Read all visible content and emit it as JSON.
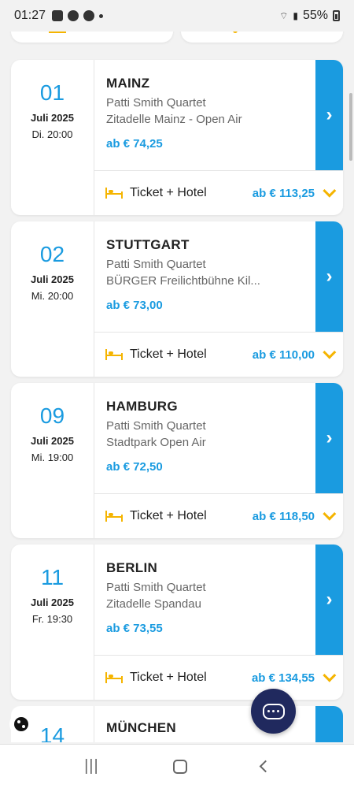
{
  "status_bar": {
    "time": "01:27",
    "battery": "55%"
  },
  "events": [
    {
      "day": "01",
      "month": "Juli 2025",
      "weekday_time": "Di. 20:00",
      "city": "MAINZ",
      "artist": "Patti Smith Quartet",
      "venue": "Zitadelle Mainz - Open Air",
      "price": "ab € 74,25",
      "hotel_label": "Ticket + Hotel",
      "hotel_price": "ab € 113,25"
    },
    {
      "day": "02",
      "month": "Juli 2025",
      "weekday_time": "Mi. 20:00",
      "city": "STUTTGART",
      "artist": "Patti Smith Quartet",
      "venue": "BÜRGER Freilichtbühne Kil...",
      "price": "ab € 73,00",
      "hotel_label": "Ticket + Hotel",
      "hotel_price": "ab € 110,00"
    },
    {
      "day": "09",
      "month": "Juli 2025",
      "weekday_time": "Mi. 19:00",
      "city": "HAMBURG",
      "artist": "Patti Smith Quartet",
      "venue": "Stadtpark Open Air",
      "price": "ab € 72,50",
      "hotel_label": "Ticket + Hotel",
      "hotel_price": "ab € 118,50"
    },
    {
      "day": "11",
      "month": "Juli 2025",
      "weekday_time": "Fr. 19:30",
      "city": "BERLIN",
      "artist": "Patti Smith Quartet",
      "venue": "Zitadelle Spandau",
      "price": "ab € 73,55",
      "hotel_label": "Ticket + Hotel",
      "hotel_price": "ab € 134,55"
    }
  ],
  "partial_event": {
    "day": "14",
    "city": "MÜNCHEN"
  },
  "icons": {
    "arrow": "chevron-right-icon",
    "hotel": "bed-icon",
    "expand": "chevron-down-icon",
    "chat": "chat-icon",
    "cookie": "cookie-icon"
  },
  "colors": {
    "accent_blue": "#1a9be0",
    "accent_yellow": "#f5b400",
    "chat_button": "#20295e"
  }
}
